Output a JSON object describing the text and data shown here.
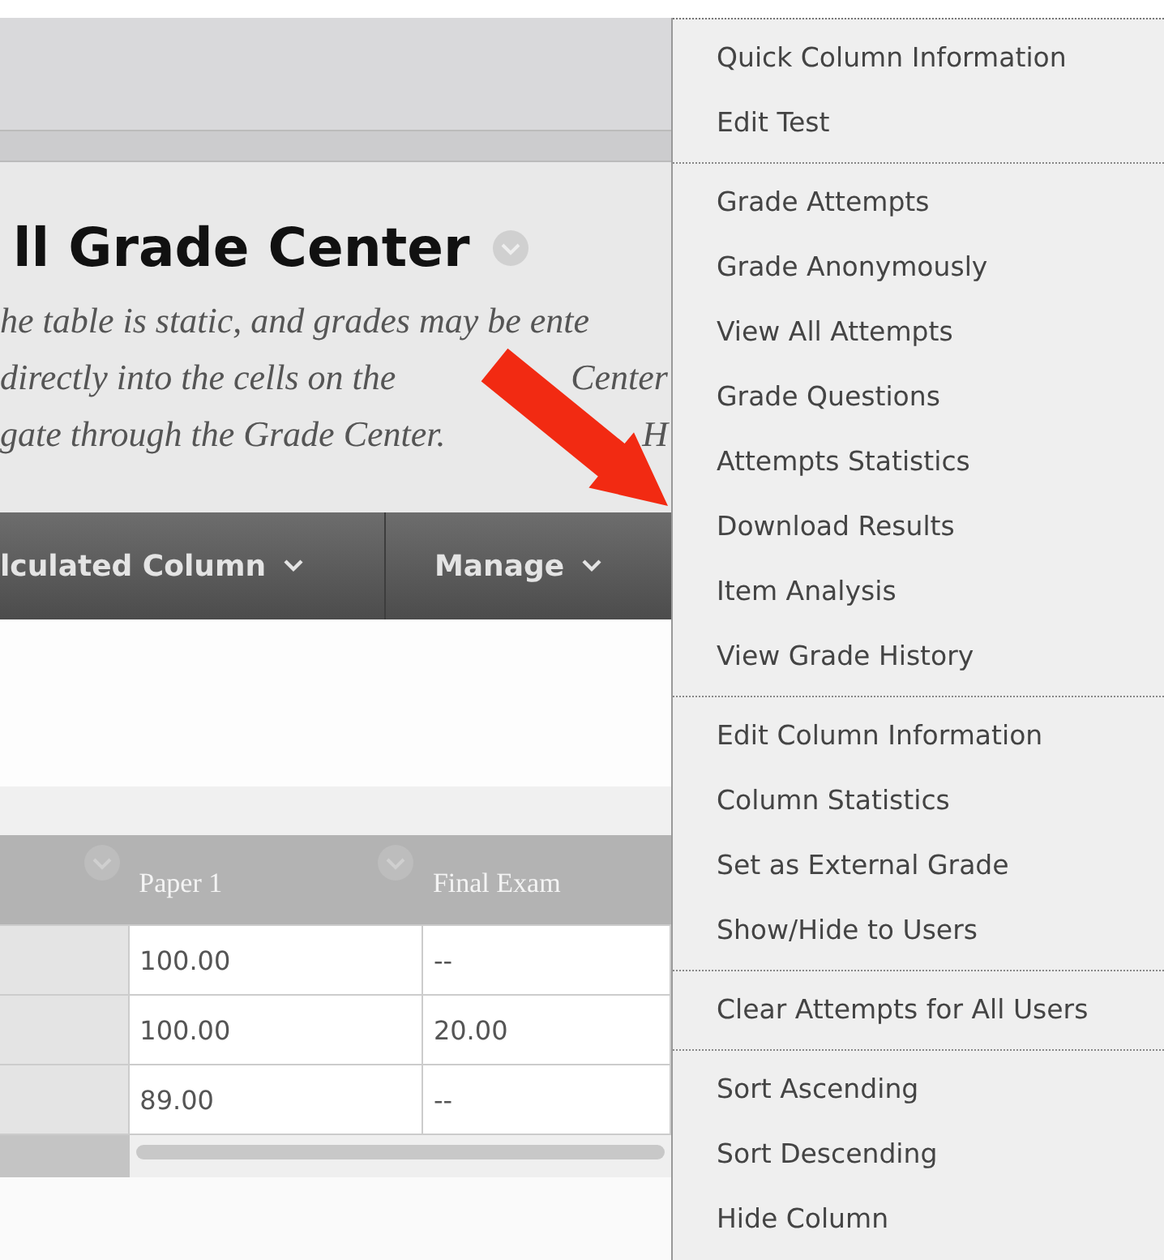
{
  "page": {
    "title": "ll Grade Center",
    "description_lines": [
      [
        "he table is static, and grades may be ente"
      ],
      [
        "directly into the cells on the",
        "Center"
      ],
      [
        "gate through the Grade Center.",
        "H"
      ]
    ]
  },
  "toolbar": [
    {
      "label": "lculated Column"
    },
    {
      "label": "Manage"
    }
  ],
  "table": {
    "columns": [
      "Paper 1",
      "Final Exam"
    ],
    "rows": [
      [
        "100.00",
        "--"
      ],
      [
        "100.00",
        "20.00"
      ],
      [
        "89.00",
        "--"
      ]
    ]
  },
  "context_menu": {
    "groups": [
      [
        "Quick Column Information",
        "Edit Test"
      ],
      [
        "Grade Attempts",
        "Grade Anonymously",
        "View All Attempts",
        "Grade Questions",
        "Attempts Statistics",
        "Download Results",
        "Item Analysis",
        "View Grade History"
      ],
      [
        "Edit Column Information",
        "Column Statistics",
        "Set as External Grade",
        "Show/Hide to Users"
      ],
      [
        "Clear Attempts for All Users"
      ],
      [
        "Sort Ascending",
        "Sort Descending",
        "Hide Column"
      ]
    ]
  }
}
